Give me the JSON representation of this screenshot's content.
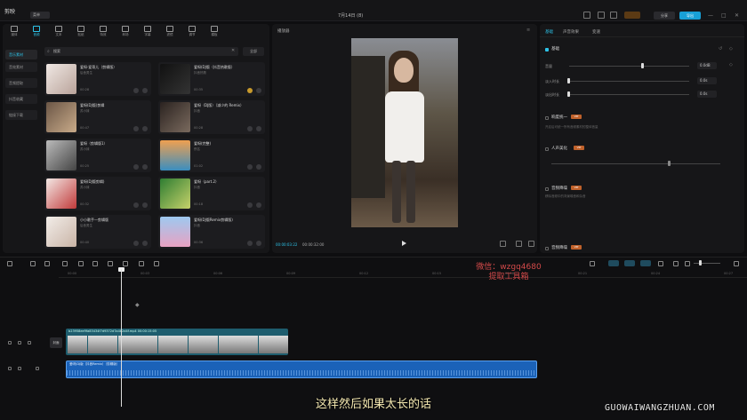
{
  "titlebar": {
    "logo": "剪映",
    "menu": "菜单",
    "title": "7月14日 (8)",
    "share": "分享",
    "export": "导出",
    "min": "—",
    "max": "□",
    "close": "✕"
  },
  "tools": [
    "媒体",
    "音频",
    "文本",
    "贴纸",
    "特效",
    "转场",
    "字幕",
    "滤镜",
    "调节",
    "模板"
  ],
  "sidebar": [
    "音乐素材",
    "音效素材",
    "音频提取",
    "抖音收藏",
    "链接下载"
  ],
  "search": {
    "value": "搜索",
    "filter": "全部"
  },
  "cards": [
    {
      "title": "爱呀·爱哥儿（剪辑版）",
      "artist": "后舍男生",
      "dur": "00:28"
    },
    {
      "title": "爱呀(DJ版（抖音热歌版）",
      "artist": "抖音热歌",
      "dur": "00:35"
    },
    {
      "title": "爱呀(DJ版)剪辑",
      "artist": "苏小妹",
      "dur": "00:47"
    },
    {
      "title": "爱呀（DJ版）（减少的 Remix）",
      "artist": "抖音",
      "dur": "00:28"
    },
    {
      "title": "爱呀（剪辑版1）",
      "artist": "苏小妹",
      "dur": "00:25"
    },
    {
      "title": "爱呀(完整)",
      "artist": "佚名",
      "dur": "01:02"
    },
    {
      "title": "爱呀(DJ版剪辑)",
      "artist": "苏小妹",
      "dur": "00:32"
    },
    {
      "title": "爱呀（part.2）",
      "artist": "抖音",
      "dur": "00:18"
    },
    {
      "title": "小小歌手—剪辑版",
      "artist": "后舍男生",
      "dur": "00:40"
    },
    {
      "title": "爱呀(DJ版Remix剪辑版)",
      "artist": "抖音",
      "dur": "00:36"
    }
  ],
  "player": {
    "title": "播放器",
    "current": "00:00:03:22",
    "total": "00:00:32:00"
  },
  "right": {
    "tabs": [
      "基础",
      "声音效果",
      "变速"
    ],
    "basic": "基础",
    "volume_label": "音量",
    "volume_val": "0.0dB",
    "volume_level": 0.6,
    "fadein_label": "淡入时长",
    "fadein_val": "0.0s",
    "fadeout_label": "淡出时长",
    "fadeout_val": "0.0s",
    "sec1": "响度统一",
    "sec1_desc": "开启后可统一所有音频素材的整体音量",
    "sec2": "人声美化",
    "sec3": "音频降噪",
    "sec3_desc": "移除音频中的背景噪音和杂音",
    "sec4": "音频降噪",
    "vip": "VIP",
    "colors": {
      "accent": "#2dc3e8",
      "vip": "#c0612a"
    }
  },
  "timeline": {
    "ticks": [
      "00:00",
      "00:03",
      "00:06",
      "00:09",
      "00:12",
      "00:15",
      "00:18",
      "00:21",
      "00:24",
      "00:27"
    ],
    "main_label": "b23958ee9fa83434f7d9372d7a4b2d4f.mp4  00:00:15:05",
    "audio_label": "爱呀(DJ版（抖音Remix）（剪辑版）",
    "cover": "封面"
  },
  "subtitle": "这样然后如果太长的话",
  "watermark": [
    "微信：wzgq4680",
    "提取工具箱"
  ],
  "site": "GUOWAIWANGZHUAN.COM"
}
